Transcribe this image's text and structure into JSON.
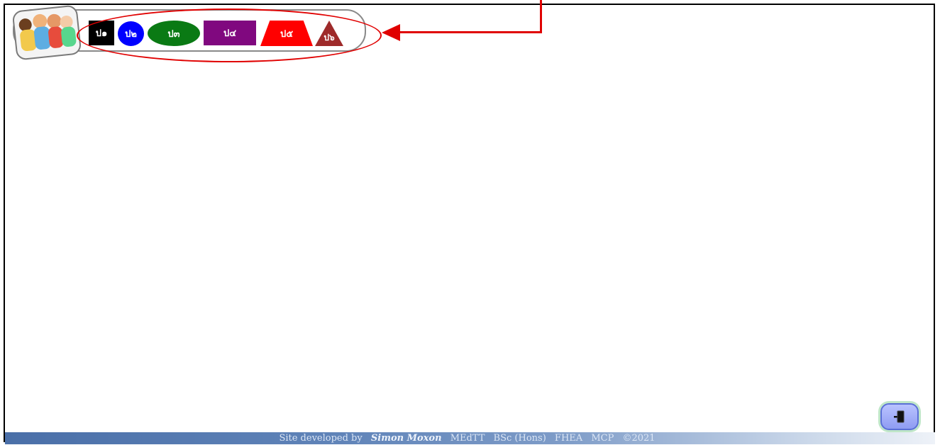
{
  "nav": {
    "buttons": [
      {
        "label": "ป๑",
        "color": "#000000",
        "shape": "square"
      },
      {
        "label": "ป๒",
        "color": "#0000ff",
        "shape": "circle"
      },
      {
        "label": "ป๓",
        "color": "#0a7a14",
        "shape": "ellipse"
      },
      {
        "label": "ป๔",
        "color": "#80087f",
        "shape": "rectangle"
      },
      {
        "label": "ป๕",
        "color": "#ff0000",
        "shape": "trapezoid"
      },
      {
        "label": "ป๖",
        "color": "#9e2a2a",
        "shape": "triangle"
      }
    ]
  },
  "annotation": {
    "color": "#e00000"
  },
  "exit_button": {
    "icon": "door-exit-icon"
  },
  "footer": {
    "prefix": "Site developed by",
    "author": "Simon Moxon",
    "credentials": [
      "MEdTT",
      "BSc (Hons)",
      "FHEA",
      "MCP",
      "©2021"
    ]
  }
}
